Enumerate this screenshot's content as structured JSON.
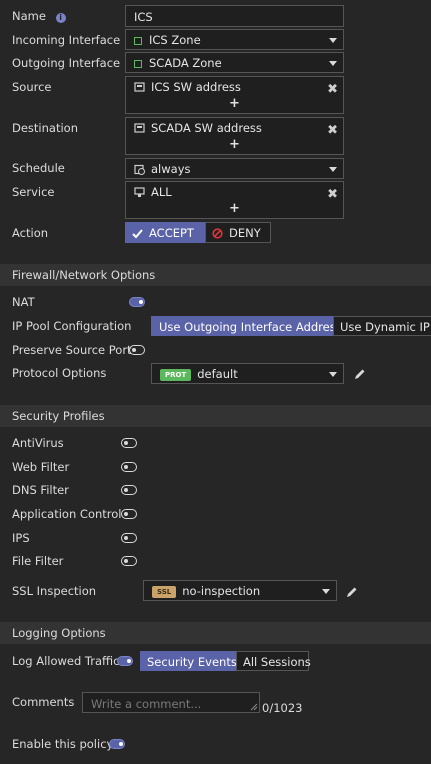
{
  "form": {
    "name": {
      "label": "Name",
      "value": "ICS"
    },
    "incoming": {
      "label": "Incoming Interface",
      "value": "ICS Zone"
    },
    "outgoing": {
      "label": "Outgoing Interface",
      "value": "SCADA Zone"
    },
    "source": {
      "label": "Source",
      "value": "ICS SW address",
      "add": "+"
    },
    "destination": {
      "label": "Destination",
      "value": "SCADA SW address",
      "add": "+"
    },
    "schedule": {
      "label": "Schedule",
      "value": "always"
    },
    "service": {
      "label": "Service",
      "value": "ALL",
      "add": "+"
    },
    "action": {
      "label": "Action",
      "accept": "ACCEPT",
      "deny": "DENY",
      "selected": "ACCEPT"
    }
  },
  "firewall": {
    "title": "Firewall/Network Options",
    "nat": {
      "label": "NAT",
      "on": true
    },
    "ip_pool": {
      "label": "IP Pool Configuration",
      "opt1": "Use Outgoing Interface Address",
      "opt2": "Use Dynamic IP P",
      "selected": 1
    },
    "preserve": {
      "label": "Preserve Source Port",
      "on": false
    },
    "protocol": {
      "label": "Protocol Options",
      "badge": "PROT",
      "value": "default"
    }
  },
  "security": {
    "title": "Security Profiles",
    "items": [
      {
        "label": "AntiVirus",
        "on": false
      },
      {
        "label": "Web Filter",
        "on": false
      },
      {
        "label": "DNS Filter",
        "on": false
      },
      {
        "label": "Application Control",
        "on": false
      },
      {
        "label": "IPS",
        "on": false
      },
      {
        "label": "File Filter",
        "on": false
      }
    ],
    "ssl": {
      "label": "SSL Inspection",
      "badge": "SSL",
      "value": "no-inspection"
    }
  },
  "logging": {
    "title": "Logging Options",
    "allowed": {
      "label": "Log Allowed Traffic",
      "on": true,
      "opt1": "Security Events",
      "opt2": "All Sessions",
      "selected": 1
    },
    "comments": {
      "label": "Comments",
      "placeholder": "Write a comment...",
      "counter": "0/1023"
    },
    "enable": {
      "label": "Enable this policy",
      "on": true
    }
  },
  "colors": {
    "accent": "#5b63a8",
    "zone": "#5cb85c",
    "deny": "#e0343a",
    "prot_badge": "#5cb85c",
    "ssl_badge": "#c9a36a"
  }
}
